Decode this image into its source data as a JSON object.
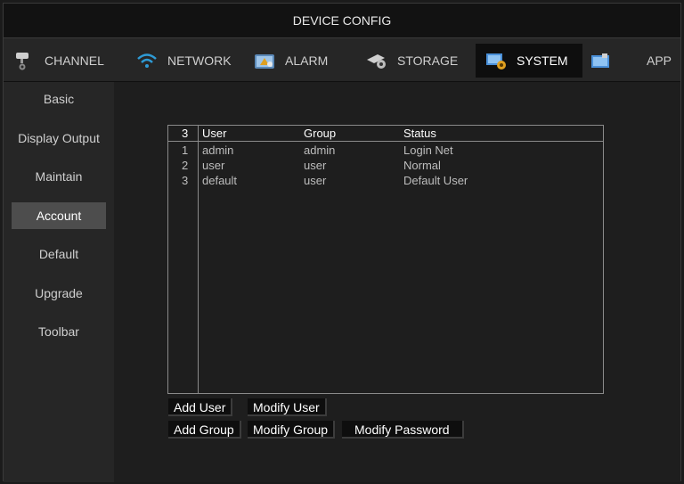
{
  "window": {
    "title": "DEVICE CONFIG"
  },
  "tabs": [
    {
      "label": "CHANNEL",
      "icon": "camera-icon"
    },
    {
      "label": "NETWORK",
      "icon": "wifi-icon"
    },
    {
      "label": "ALARM",
      "icon": "alarm-icon"
    },
    {
      "label": "STORAGE",
      "icon": "storage-icon"
    },
    {
      "label": "SYSTEM",
      "icon": "system-icon",
      "active": true
    },
    {
      "label": "APP",
      "icon": "app-icon"
    }
  ],
  "sidebar": {
    "items": [
      {
        "label": "Basic"
      },
      {
        "label": "Display Output"
      },
      {
        "label": "Maintain"
      },
      {
        "label": "Account",
        "active": true
      },
      {
        "label": "Default"
      },
      {
        "label": "Upgrade"
      },
      {
        "label": "Toolbar"
      }
    ]
  },
  "table": {
    "headers": {
      "count": "3",
      "user": "User",
      "group": "Group",
      "status": "Status"
    },
    "rows": [
      {
        "no": "1",
        "user": "admin",
        "group": "admin",
        "status": "Login Net"
      },
      {
        "no": "2",
        "user": "user",
        "group": "user",
        "status": "Normal"
      },
      {
        "no": "3",
        "user": "default",
        "group": "user",
        "status": "Default User"
      }
    ]
  },
  "buttons": {
    "add_user": "Add User",
    "modify_user": "Modify User",
    "add_group": "Add Group",
    "modify_group": "Modify Group",
    "modify_password": "Modify Password"
  },
  "colors": {
    "accent_wifi": "#2e9bd6",
    "active_tab_bg": "#0e0e0e",
    "active_side_bg": "#4d4d4d"
  }
}
